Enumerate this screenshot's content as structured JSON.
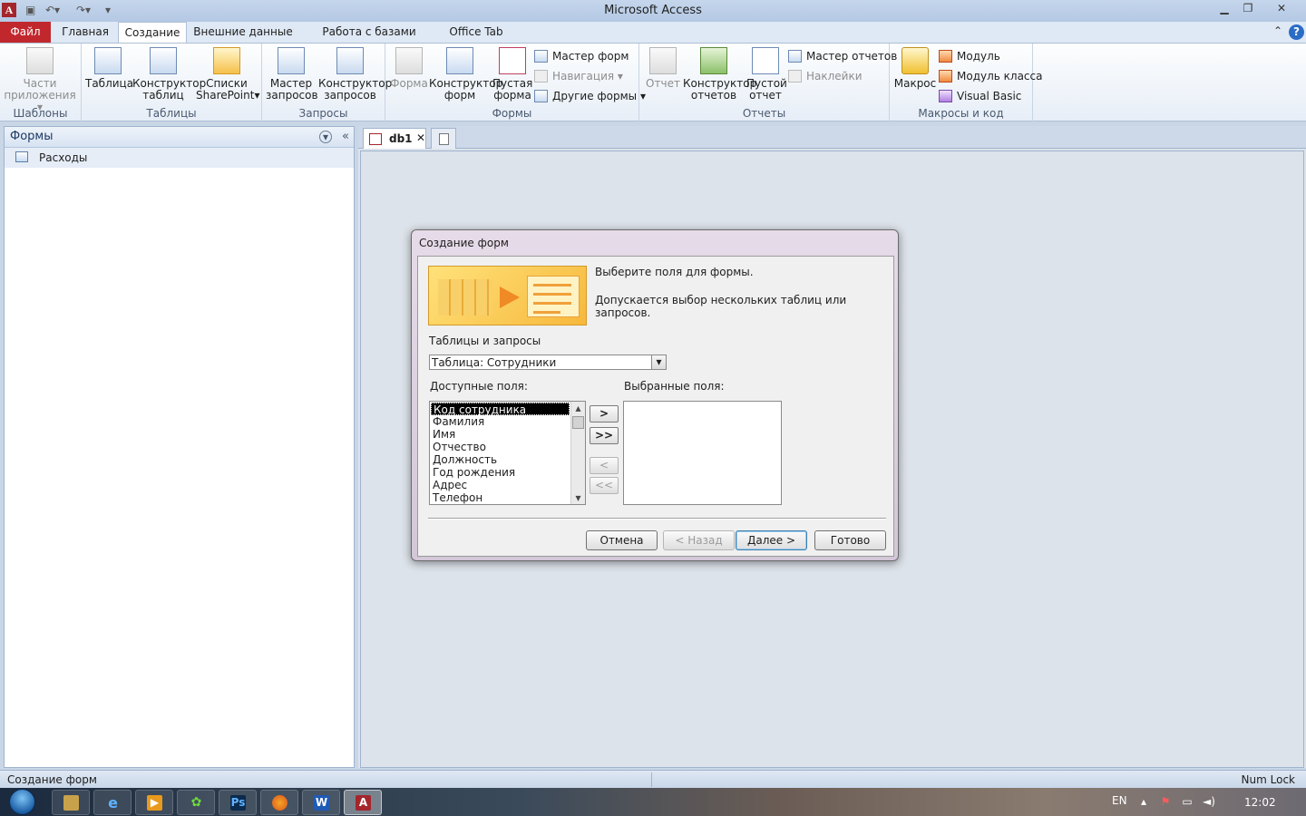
{
  "window": {
    "title": "Microsoft Access",
    "app_icon": "A"
  },
  "ribbon_tabs": {
    "file": "Файл",
    "home": "Главная",
    "create": "Создание",
    "external": "Внешние данные",
    "dbtools": "Работа с базами данных",
    "officetab": "Office Tab"
  },
  "ribbon": {
    "templates": {
      "label": "Шаблоны",
      "app_parts": [
        "Части",
        "приложения"
      ]
    },
    "tables": {
      "label": "Таблицы",
      "table": "Таблица",
      "table_design": [
        "Конструктор",
        "таблиц"
      ],
      "sharepoint": [
        "Списки",
        "SharePoint"
      ]
    },
    "queries": {
      "label": "Запросы",
      "wizard": [
        "Мастер",
        "запросов"
      ],
      "design": [
        "Конструктор",
        "запросов"
      ]
    },
    "forms": {
      "label": "Формы",
      "form": "Форма",
      "form_design": [
        "Конструктор",
        "форм"
      ],
      "blank_form": [
        "Пустая",
        "форма"
      ],
      "form_wizard": "Мастер форм",
      "navigation": "Навигация",
      "more_forms": "Другие формы"
    },
    "reports": {
      "label": "Отчеты",
      "report": "Отчет",
      "report_design": [
        "Конструктор",
        "отчетов"
      ],
      "blank_report": [
        "Пустой",
        "отчет"
      ],
      "report_wizard": "Мастер отчетов",
      "labels": "Наклейки"
    },
    "macros": {
      "label": "Макросы и код",
      "macro": "Макрос",
      "module": "Модуль",
      "class_module": "Модуль класса",
      "vb": "Visual Basic"
    }
  },
  "nav": {
    "title": "Формы",
    "items": [
      "Расходы"
    ]
  },
  "doc_tabs": {
    "db": "db1"
  },
  "dialog": {
    "title": "Создание форм",
    "line1": "Выберите поля для формы.",
    "line2": "Допускается выбор нескольких таблиц или запросов.",
    "tables_label": "Таблицы и запросы",
    "table_value": "Таблица: Сотрудники",
    "available_label": "Доступные поля:",
    "selected_label": "Выбранные поля:",
    "available_fields": [
      "Код сотрудника",
      "Фамилия",
      "Имя",
      "Отчество",
      "Должность",
      "Год рождения",
      "Адрес",
      "Телефон"
    ],
    "move_buttons": {
      "one": ">",
      "all": ">>",
      "back_one": "<",
      "back_all": "<<"
    },
    "buttons": {
      "cancel": "Отмена",
      "back": "< Назад",
      "next": "Далее >",
      "finish": "Готово"
    }
  },
  "status": {
    "left": "Создание форм",
    "right": "Num Lock"
  },
  "taskbar": {
    "lang": "EN",
    "clock": "12:02"
  }
}
